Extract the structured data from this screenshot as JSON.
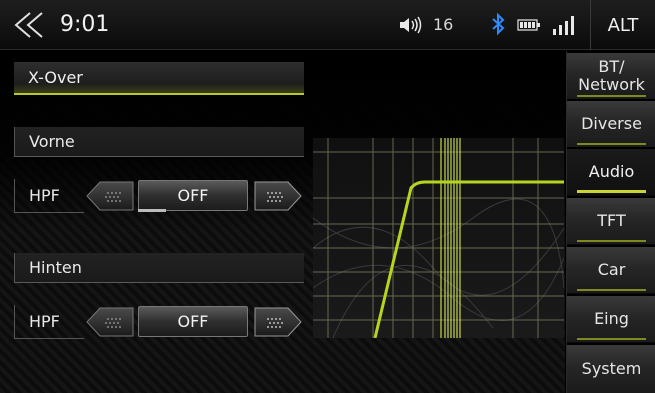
{
  "status": {
    "time": "9:01",
    "volume": "16",
    "alt_label": "ALT"
  },
  "panel": {
    "title": "X-Over",
    "front": {
      "label": "Vorne",
      "hpf_label": "HPF",
      "hpf_value": "OFF"
    },
    "rear": {
      "label": "Hinten",
      "hpf_label": "HPF",
      "hpf_value": "OFF"
    }
  },
  "sidebar": {
    "items": [
      {
        "label": "BT/\nNetwork"
      },
      {
        "label": "Diverse"
      },
      {
        "label": "Audio",
        "active": true
      },
      {
        "label": "TFT"
      },
      {
        "label": "Car"
      },
      {
        "label": "Eing"
      },
      {
        "label": "System"
      }
    ]
  },
  "colors": {
    "accent": "#c9d636",
    "curve": "#b6d51f"
  },
  "icons": [
    "back-icon",
    "volume-icon",
    "bluetooth-icon",
    "battery-icon",
    "signal-icon",
    "arrow-left-icon",
    "arrow-right-icon"
  ]
}
